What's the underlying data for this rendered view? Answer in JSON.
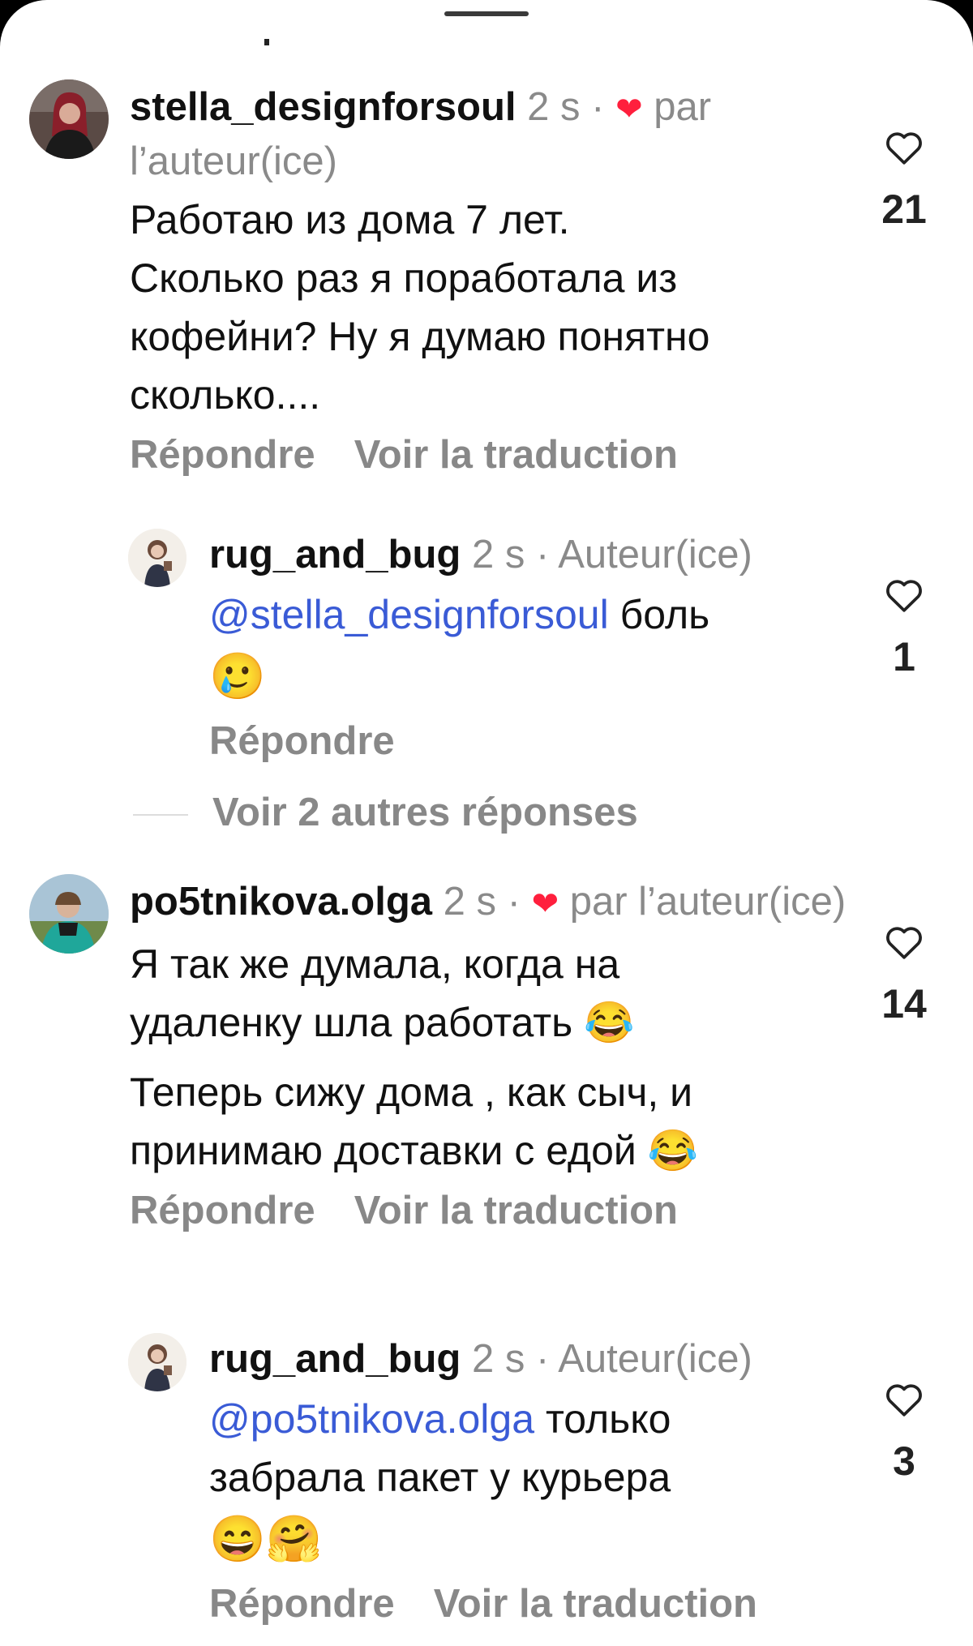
{
  "comments": [
    {
      "username": "stella_designforsoul",
      "time": "2 s",
      "sep": "·",
      "liked_by_author": "par l’auteur(ice)",
      "text_lines": [
        "Работаю из дома 7 лет.",
        "Сколько раз я поработала из",
        "кофейни? Ну я думаю понятно",
        "сколько...."
      ],
      "actions": [
        "Répondre",
        "Voir la traduction"
      ],
      "likes": "21",
      "reply": {
        "username": "rug_and_bug",
        "time": "2 s",
        "author_tag": "· Auteur(ice)",
        "mention": "@stella_designforsoul",
        "text_after": "боль",
        "emoji_line": "🥲",
        "actions": [
          "Répondre"
        ],
        "likes": "1"
      },
      "more_replies": "Voir 2 autres réponses"
    },
    {
      "username": "po5tnikova.olga",
      "time": "2 s",
      "sep": "·",
      "liked_by_author": "par l’auteur(ice)",
      "text_lines": [
        "Я так же думала, когда на",
        "удаленку шла работать 😂",
        "Теперь сижу дома , как сыч, и",
        "принимаю доставки с едой 😂"
      ],
      "actions": [
        "Répondre",
        "Voir la traduction"
      ],
      "likes": "14",
      "reply": {
        "username": "rug_and_bug",
        "time": "2 s",
        "author_tag": "· Auteur(ice)",
        "mention": "@po5tnikova.olga",
        "text_after": "только",
        "text_line2": "забрала пакет у курьера",
        "emoji_line": "😄🤗",
        "actions": [
          "Répondre",
          "Voir la traduction"
        ],
        "likes": "3"
      }
    }
  ],
  "colors": {
    "mention": "#3a5bd6",
    "heart": "#ff1f3d",
    "muted": "#888888"
  },
  "icons": [
    "heart-outline-icon",
    "heart-filled-icon"
  ]
}
